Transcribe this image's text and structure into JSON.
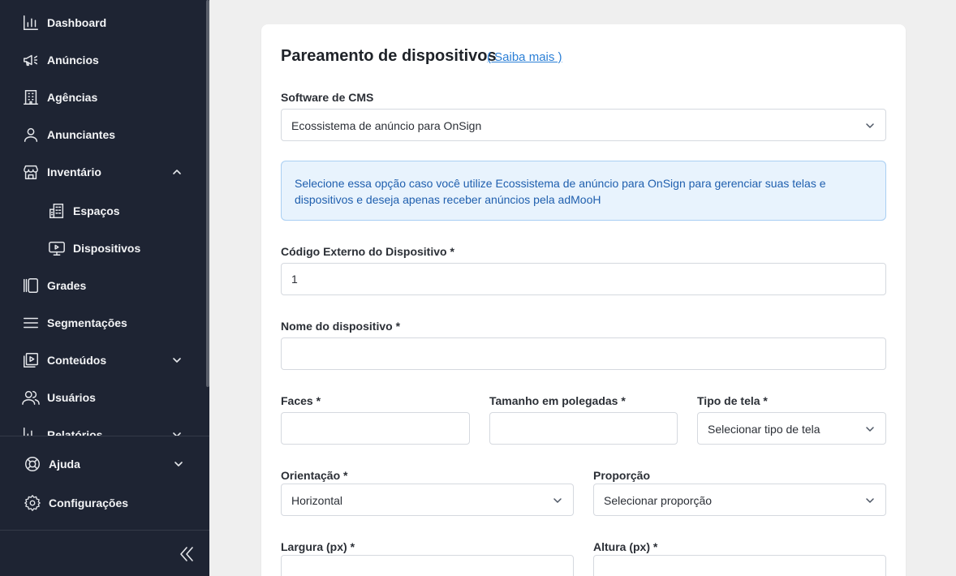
{
  "sidebar": {
    "items": [
      {
        "label": "Dashboard",
        "icon": "chart-bar-icon"
      },
      {
        "label": "Anúncios",
        "icon": "megaphone-icon"
      },
      {
        "label": "Agências",
        "icon": "building-icon"
      },
      {
        "label": "Anunciantes",
        "icon": "user-icon"
      },
      {
        "label": "Inventário",
        "icon": "store-icon",
        "expanded": true
      },
      {
        "label": "Espaços",
        "icon": "building-office-icon"
      },
      {
        "label": "Dispositivos",
        "icon": "monitor-play-icon"
      },
      {
        "label": "Grades",
        "icon": "columns-icon"
      },
      {
        "label": "Segmentações",
        "icon": "menu-lines-icon"
      },
      {
        "label": "Conteúdos",
        "icon": "play-square-icon",
        "expanded": false
      },
      {
        "label": "Usuários",
        "icon": "users-icon"
      },
      {
        "label": "Relatórios",
        "icon": "chart-icon",
        "expanded": false
      }
    ],
    "footer": [
      {
        "label": "Ajuda",
        "icon": "lifebuoy-icon"
      },
      {
        "label": "Configurações",
        "icon": "gear-icon"
      }
    ],
    "collapse_icon": "chevrons-left-icon"
  },
  "form": {
    "title": "Pareamento de dispositivos",
    "learn_more": "( Saiba mais )",
    "cms_label": "Software de CMS",
    "cms_value": "Ecossistema de anúncio para OnSign",
    "info_text": "Selecione essa opção caso você utilize Ecossistema de anúncio para OnSign para gerenciar suas telas e dispositivos e deseja apenas receber anúncios pela adMooH",
    "external_code_label": "Código Externo do Dispositivo *",
    "external_code_value": "1",
    "device_name_label": "Nome do dispositivo *",
    "device_name_value": "",
    "faces_label": "Faces *",
    "faces_value": "",
    "size_label": "Tamanho em polegadas *",
    "size_value": "",
    "screen_type_label": "Tipo de tela *",
    "screen_type_value": "Selecionar tipo de tela",
    "orientation_label": "Orientação *",
    "orientation_value": "Horizontal",
    "proportion_label": "Proporção",
    "proportion_value": "Selecionar proporção",
    "width_label": "Largura (px) *",
    "width_value": "",
    "height_label": "Altura (px) *",
    "height_value": ""
  },
  "colors": {
    "sidebar_bg": "#1e2433",
    "page_bg": "#efefef",
    "link": "#2b7fd6",
    "info_bg": "#e8f3fd",
    "info_text": "#1f5fae"
  }
}
